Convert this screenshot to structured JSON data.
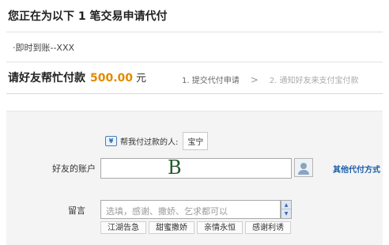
{
  "header": {
    "title": "您正在为以下 1 笔交易申请代付"
  },
  "orders": [
    {
      "label": "·即时到账--XXX"
    }
  ],
  "payment": {
    "title": "请好友帮忙付款",
    "amount": "500.00",
    "unit": "元",
    "steps": [
      "1. 提交代付申请",
      "2. 通知好友来支付宝付款"
    ],
    "step_arrow": ">"
  },
  "form": {
    "helper_label": "帮我付过款的人:",
    "helper_name": "宝宁",
    "account_label": "好友的账户",
    "account_value": "B",
    "other_method": "其他代付方式",
    "message_label": "留言",
    "message_placeholder": "选填，感谢、撒娇、乞求都可以",
    "quick_phrases": [
      "江湖告急",
      "甜蜜撒娇",
      "亲情永恒",
      "感谢利诱"
    ]
  },
  "colors": {
    "amount": "#e08a00",
    "link": "#1a5ea8",
    "panel_bg": "#f4f4f4"
  },
  "icons": {
    "helper": "money-icon",
    "contact": "contact-person-icon"
  }
}
